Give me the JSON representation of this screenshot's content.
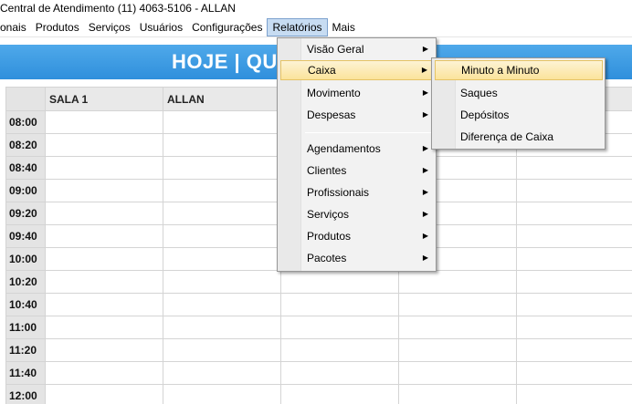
{
  "window": {
    "title": "Central de Atendimento (11) 4063-5106 - ALLAN"
  },
  "menubar": {
    "items": [
      {
        "label": "onais"
      },
      {
        "label": "Produtos"
      },
      {
        "label": "Serviços"
      },
      {
        "label": "Usuários"
      },
      {
        "label": "Configurações"
      },
      {
        "label": "Relatórios"
      },
      {
        "label": "Mais"
      }
    ],
    "active_index": 5
  },
  "banner": {
    "text": "HOJE | QU"
  },
  "schedule": {
    "columns": [
      "SALA 1",
      "ALLAN",
      "",
      "",
      ""
    ],
    "times": [
      "08:00",
      "08:20",
      "08:40",
      "09:00",
      "09:20",
      "09:40",
      "10:00",
      "10:20",
      "10:40",
      "11:00",
      "11:20",
      "11:40",
      "12:00"
    ]
  },
  "relatorios_menu": {
    "items": [
      {
        "label": "Visão Geral",
        "submenu": true
      },
      {
        "label": "Caixa",
        "submenu": true,
        "highlighted": true
      },
      {
        "label": "Movimento",
        "submenu": true
      },
      {
        "label": "Despesas",
        "submenu": true
      },
      {
        "label": "Agendamentos",
        "submenu": true
      },
      {
        "label": "Clientes",
        "submenu": true
      },
      {
        "label": "Profissionais",
        "submenu": true
      },
      {
        "label": "Serviços",
        "submenu": true
      },
      {
        "label": "Produtos",
        "submenu": true
      },
      {
        "label": "Pacotes",
        "submenu": true
      }
    ],
    "arrow_glyph": "▶"
  },
  "caixa_submenu": {
    "items": [
      {
        "label": "Minuto a Minuto",
        "highlighted": true
      },
      {
        "label": "Saques"
      },
      {
        "label": "Depósitos"
      },
      {
        "label": "Diferença de Caixa"
      }
    ]
  },
  "colors": {
    "banner": "#3a9be3",
    "menu_highlight": "#fbe39b",
    "menubar_active": "#c7dcf2"
  }
}
